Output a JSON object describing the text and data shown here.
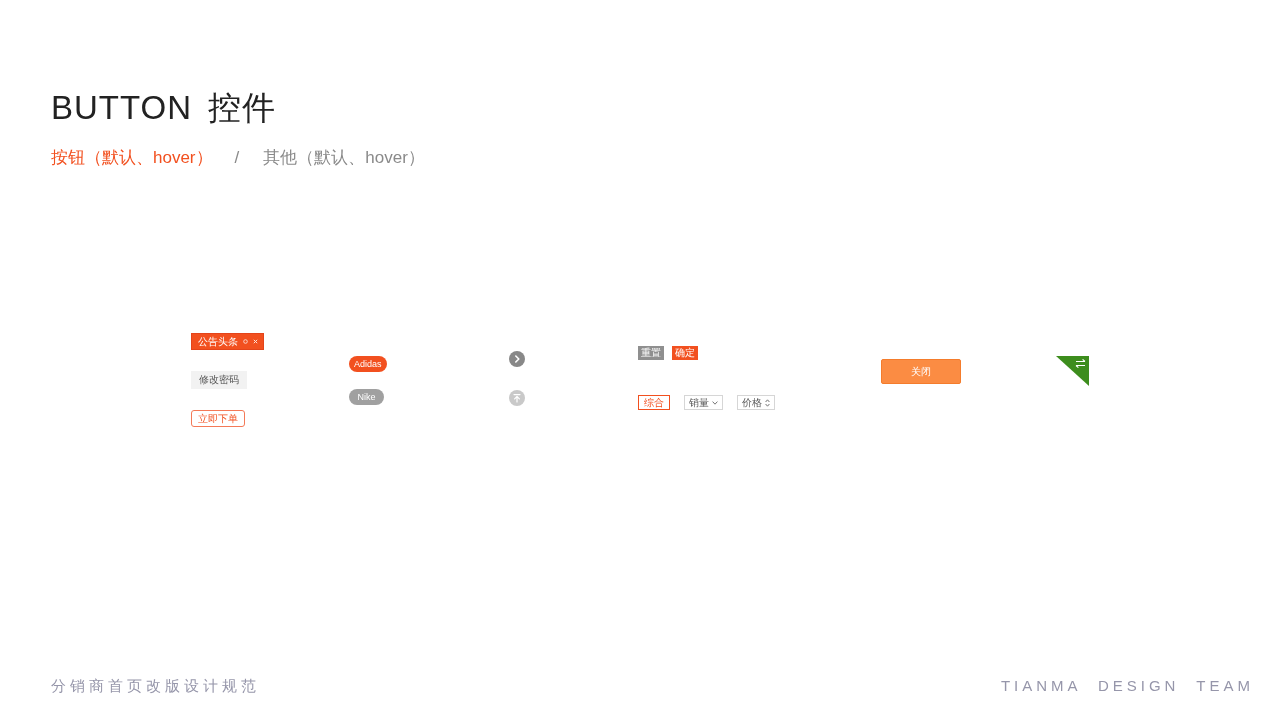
{
  "header": {
    "title": "BUTTON 控件",
    "tabs": [
      {
        "label": "按钮（默认、hover）",
        "selected": true
      },
      {
        "label": "其他（默认、hover）",
        "selected": false
      }
    ],
    "separator": "/"
  },
  "board": {
    "basic_buttons": [
      {
        "kind": "tag",
        "label": "公告头条"
      },
      {
        "kind": "plain",
        "label": "修改密码"
      },
      {
        "kind": "outline",
        "label": "立即下单"
      }
    ],
    "brand_pills": [
      {
        "label": "Adidas",
        "selected": true
      },
      {
        "label": "Nike",
        "selected": false
      }
    ],
    "form_actions": [
      {
        "kind": "secondary",
        "label": "重置"
      },
      {
        "kind": "primary",
        "label": "确定"
      }
    ],
    "sort_tabs": [
      {
        "kind": "plain",
        "label": "综合",
        "selected": true
      },
      {
        "kind": "dropdown",
        "label": "销量",
        "selected": false
      },
      {
        "kind": "sort",
        "label": "价格",
        "selected": false
      }
    ],
    "close_button": {
      "label": "关闭"
    }
  },
  "footer": {
    "project": "分销商首页改版设计规范",
    "team": "TIANMA DESIGN TEAM"
  }
}
